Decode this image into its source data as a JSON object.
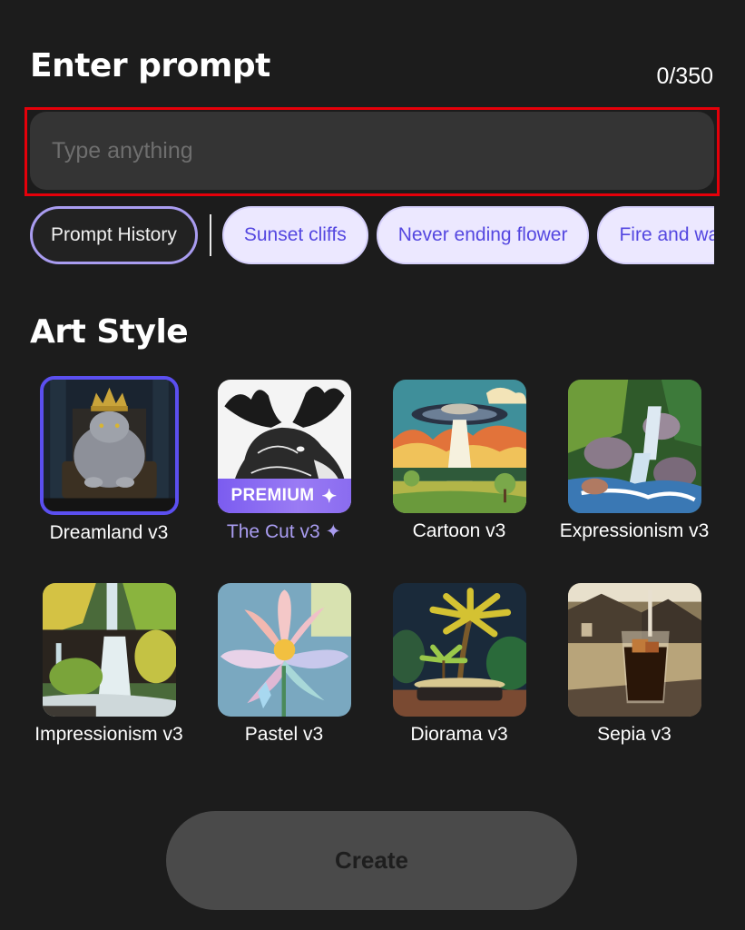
{
  "prompt": {
    "title": "Enter prompt",
    "char_count": "0/350",
    "input_value": "",
    "placeholder": "Type anything"
  },
  "chips": {
    "history_label": "Prompt History",
    "suggestions": [
      "Sunset cliffs",
      "Never ending flower",
      "Fire and water"
    ]
  },
  "art_style": {
    "title": "Art Style",
    "selected": "Dreamland v3",
    "styles": [
      {
        "label": "Dreamland v3",
        "image": "crowned-cat-on-throne",
        "selected": true
      },
      {
        "label": "The Cut v3 ✦",
        "image": "moose-ink-engraving",
        "premium": true,
        "badge": "PREMIUM",
        "badge_icon": "✦"
      },
      {
        "label": "Cartoon v3",
        "image": "ufo-cartoon"
      },
      {
        "label": "Expressionism v3",
        "image": "rocky-waterfall"
      },
      {
        "label": "Impressionism v3",
        "image": "forest-waterfall"
      },
      {
        "label": "Pastel v3",
        "image": "pastel-lotus-flower"
      },
      {
        "label": "Diorama v3",
        "image": "palm-tree-diorama"
      },
      {
        "label": "Sepia v3",
        "image": "iced-drink-sepia"
      }
    ]
  },
  "actions": {
    "create_label": "Create"
  },
  "colors": {
    "background": "#1c1c1c",
    "accent": "#5b4ff0",
    "chip_bg": "#ece8ff",
    "chip_text": "#5447e0",
    "focus_outline": "#e5000a",
    "button_disabled": "#4a4a4a"
  }
}
